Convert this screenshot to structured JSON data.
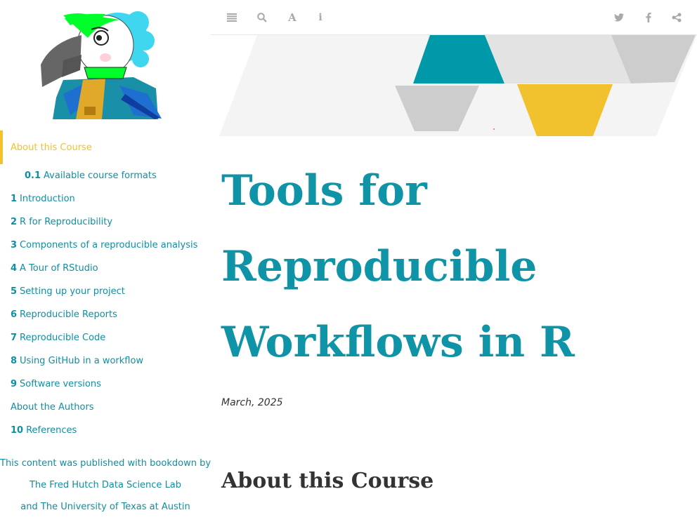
{
  "toolbar": {
    "icons": [
      "toc-toggle-icon",
      "search-icon",
      "font-settings-icon",
      "info-icon",
      "twitter-icon",
      "facebook-icon",
      "share-icon"
    ]
  },
  "sidebar": {
    "items": [
      {
        "num": "",
        "label": "About this Course",
        "active": true
      },
      {
        "num": "0.1",
        "label": "Available course formats"
      },
      {
        "num": "1",
        "label": "Introduction"
      },
      {
        "num": "2",
        "label": "R for Reproducibility"
      },
      {
        "num": "3",
        "label": "Components of a reproducible analysis"
      },
      {
        "num": "4",
        "label": "A Tour of RStudio"
      },
      {
        "num": "5",
        "label": "Setting up your project"
      },
      {
        "num": "6",
        "label": "Reproducible Reports"
      },
      {
        "num": "7",
        "label": "Reproducible Code"
      },
      {
        "num": "8",
        "label": "Using GitHub in a workflow"
      },
      {
        "num": "9",
        "label": "Software versions"
      },
      {
        "num": "",
        "label": "About the Authors"
      },
      {
        "num": "10",
        "label": "References"
      }
    ],
    "credits": {
      "line1": "This content was published with bookdown by:",
      "line2": "The Fred Hutch Data Science Lab",
      "line3": "and The University of Texas at Austin"
    }
  },
  "main": {
    "title": "Tools for Reproducible Workflows in R",
    "date": "March, 2025",
    "section_title": "About this Course"
  },
  "colors": {
    "accent": "#0e94a6",
    "active": "#f2c12e",
    "icon": "#a9a9a9"
  }
}
